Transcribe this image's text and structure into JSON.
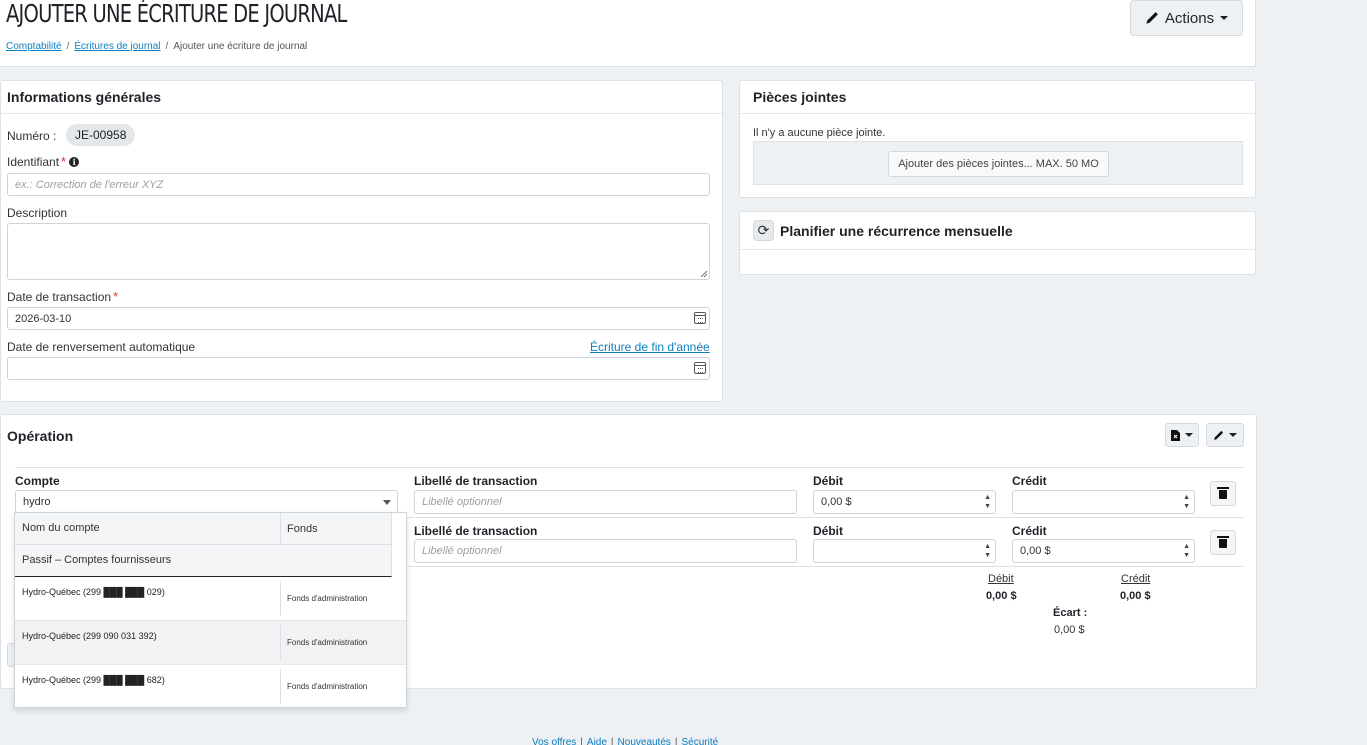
{
  "header": {
    "title": "Ajouter une écriture de journal",
    "breadcrumb": [
      "Comptabilité",
      "Écritures de journal",
      "Ajouter une écriture de journal"
    ],
    "actions_label": "Actions"
  },
  "info": {
    "title": "Informations générales",
    "numero_label": "Numéro :",
    "numero_value": "JE-00958",
    "identifiant_label": "Identifiant",
    "identifiant_placeholder": "ex.: Correction de l'erreur XYZ",
    "description_label": "Description",
    "date_label": "Date de transaction",
    "date_value": "2026-03-10",
    "reversal_label": "Date de renversement automatique",
    "eoy_link": "Écriture de fin d'année"
  },
  "attachments": {
    "title": "Pièces jointes",
    "empty_text": "Il n'y a aucune pièce jointe.",
    "add_button": "Ajouter des pièces jointes... MAX. 50 MO"
  },
  "recurrence": {
    "title": "Planifier une récurrence mensuelle"
  },
  "operation": {
    "title": "Opération",
    "headers": {
      "compte": "Compte",
      "libelle": "Libellé de transaction",
      "debit": "Débit",
      "credit": "Crédit"
    },
    "libelle_placeholder": "Libellé optionnel",
    "rows": [
      {
        "compte": "hydro",
        "debit": "0,00 $",
        "credit": ""
      },
      {
        "compte": "",
        "debit": "",
        "credit": "0,00 $"
      }
    ],
    "totals": {
      "debit_label": "Débit",
      "debit_value": "0,00 $",
      "credit_label": "Crédit",
      "credit_value": "0,00 $",
      "ecart_label": "Écart :",
      "ecart_value": "0,00 $"
    }
  },
  "dropdown": {
    "col_name": "Nom du compte",
    "col_fund": "Fonds",
    "group": "Passif – Comptes fournisseurs",
    "items": [
      {
        "name": "Hydro-Québec (299 ███ ███ 029)",
        "fund": "Fonds d'administration"
      },
      {
        "name": "Hydro-Québec (299 090 031 392)",
        "fund": "Fonds d'administration"
      },
      {
        "name": "Hydro-Québec (299 ███ ███ 682)",
        "fund": "Fonds d'administration"
      }
    ]
  },
  "footer": {
    "links": [
      "Vos offres",
      "Aide",
      "Nouveautés",
      "Sécurité"
    ]
  }
}
